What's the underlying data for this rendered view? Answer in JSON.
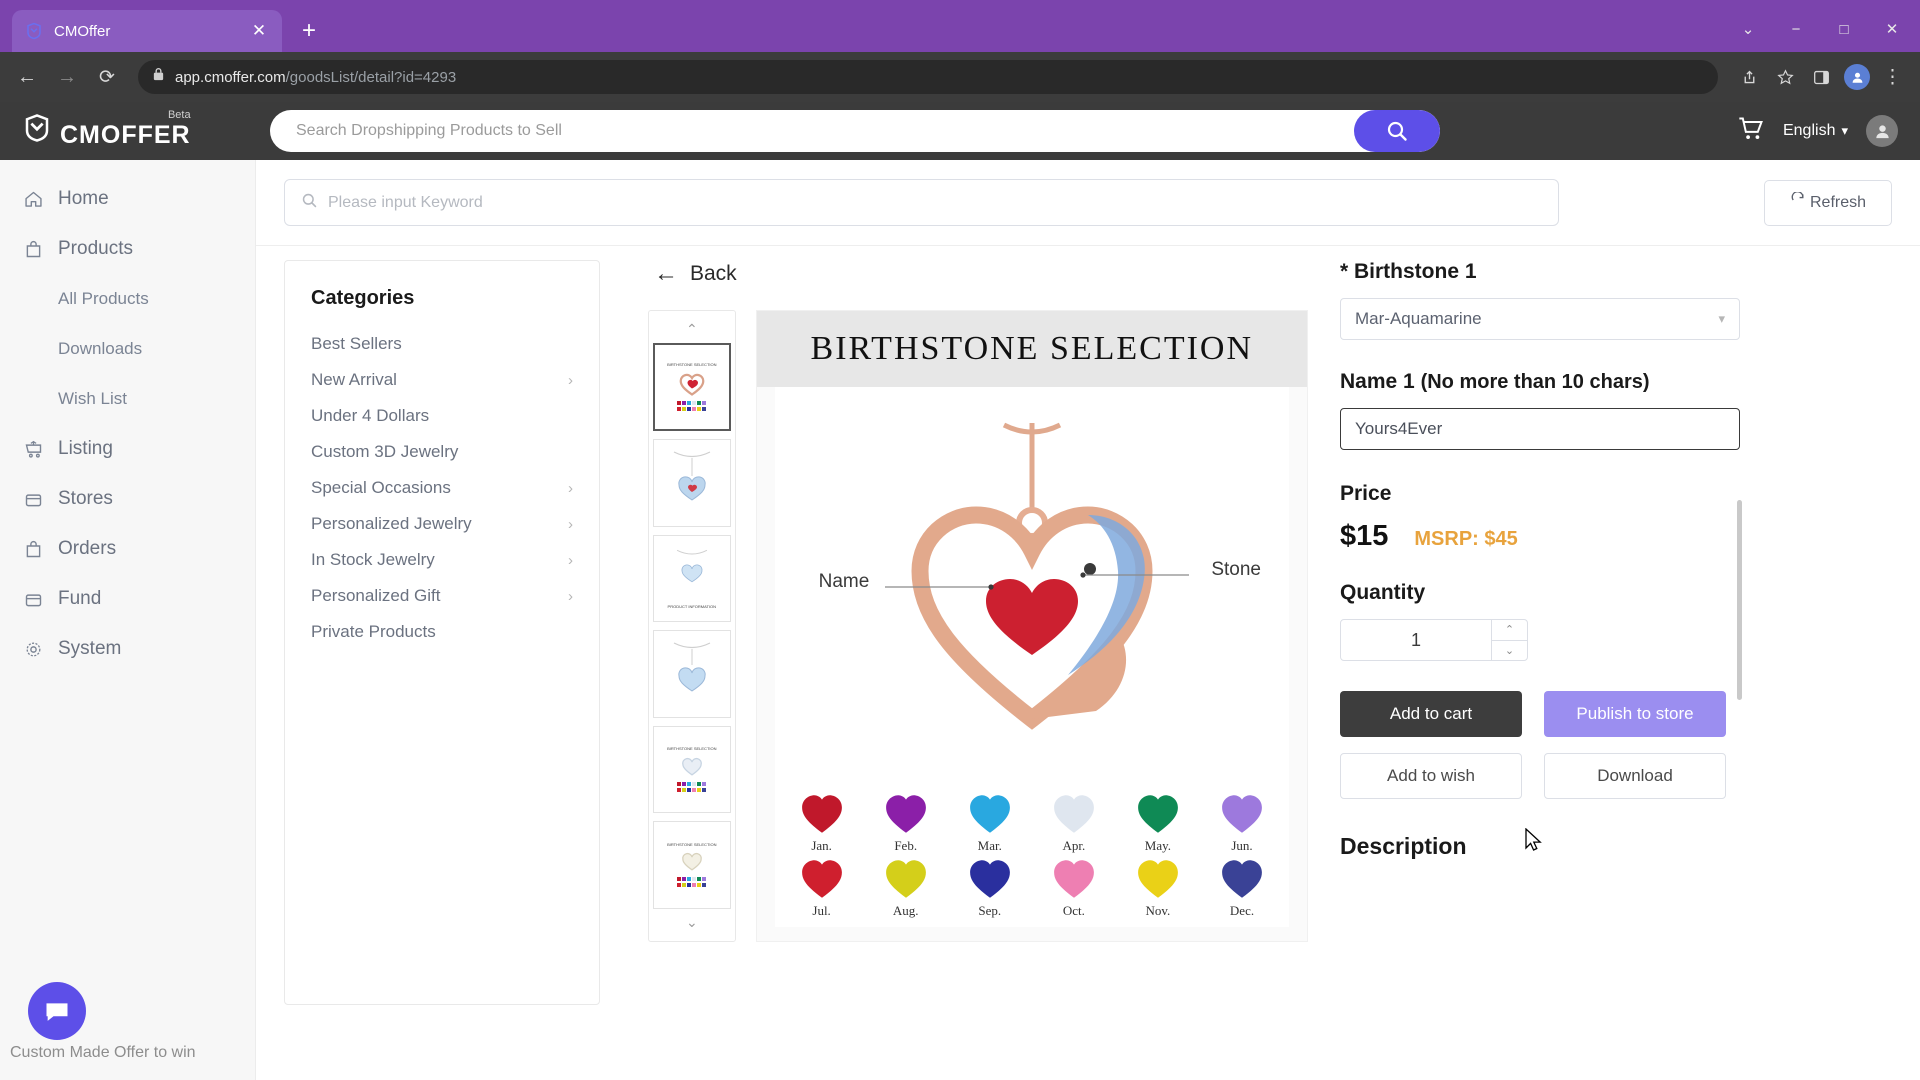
{
  "browser": {
    "tab": {
      "title": "CMOffer",
      "favicon": "cmoffer-logo-icon",
      "close": "✕"
    },
    "new_tab": "+",
    "window_controls": {
      "minimize": "−",
      "maximize": "□",
      "close": "✕",
      "chevron": "⌄"
    },
    "nav": {
      "back": "←",
      "forward": "→",
      "reload": "⟳"
    },
    "url": {
      "scheme_icon": "lock-icon",
      "host": "app.cmoffer.com",
      "path": "/goodsList/detail?id=4293"
    },
    "toolbar_icons": [
      "share-icon",
      "bookmark-star-icon",
      "sidepanel-icon",
      "profile-icon",
      "menu-kebab-icon"
    ]
  },
  "header": {
    "brand": "CMOFFER",
    "brand_badge": "Beta",
    "search_placeholder": "Search Dropshipping Products to Sell",
    "search_value": "",
    "cart_icon": "cart-icon",
    "language": "English",
    "language_chevron": "⌄",
    "account_icon": "account-icon"
  },
  "sidebar": {
    "items": [
      {
        "label": "Home",
        "icon": "home-icon",
        "type": "top"
      },
      {
        "label": "Products",
        "icon": "bag-icon",
        "type": "top"
      },
      {
        "label": "All Products",
        "icon": "",
        "type": "sub"
      },
      {
        "label": "Downloads",
        "icon": "",
        "type": "sub"
      },
      {
        "label": "Wish List",
        "icon": "",
        "type": "sub"
      },
      {
        "label": "Listing",
        "icon": "listing-cart-icon",
        "type": "top"
      },
      {
        "label": "Stores",
        "icon": "store-icon",
        "type": "top"
      },
      {
        "label": "Orders",
        "icon": "bag-icon",
        "type": "top"
      },
      {
        "label": "Fund",
        "icon": "store-icon",
        "type": "top"
      },
      {
        "label": "System",
        "icon": "gear-icon",
        "type": "top"
      }
    ],
    "footnote": "Custom Made Offer to win"
  },
  "searchbar": {
    "placeholder": "Please input Keyword",
    "value": "",
    "refresh_label": "Refresh",
    "refresh_icon": "refresh-icon"
  },
  "categories": {
    "title": "Categories",
    "items": [
      {
        "label": "Best Sellers",
        "expandable": false
      },
      {
        "label": "New Arrival",
        "expandable": true
      },
      {
        "label": "Under 4 Dollars",
        "expandable": false
      },
      {
        "label": "Custom 3D Jewelry",
        "expandable": false
      },
      {
        "label": "Special Occasions",
        "expandable": true
      },
      {
        "label": "Personalized Jewelry",
        "expandable": true
      },
      {
        "label": "In Stock Jewelry",
        "expandable": true
      },
      {
        "label": "Personalized Gift",
        "expandable": true
      },
      {
        "label": "Private Products",
        "expandable": false
      }
    ],
    "chevron": "›"
  },
  "detail": {
    "back_label": "Back",
    "back_icon": "arrow-left-icon",
    "gallery": {
      "up_arrow": "⌃",
      "down_arrow": "⌄",
      "selected_index": 0,
      "thumbnails": [
        {
          "caption": "BIRTHSTONE SELECTION"
        },
        {
          "caption": ""
        },
        {
          "caption": "PRODUCT INFORMATION"
        },
        {
          "caption": ""
        },
        {
          "caption": "BIRTHSTONE SELECTION"
        },
        {
          "caption": "BIRTHSTONE SELECTION"
        }
      ]
    },
    "hero": {
      "title": "BIRTHSTONE SELECTION",
      "annotation_left": "Name",
      "annotation_right": "Stone",
      "months_row1": [
        "Jan.",
        "Feb.",
        "Mar.",
        "Apr.",
        "May.",
        "Jun."
      ],
      "months_row2": [
        "Jul.",
        "Aug.",
        "Sep.",
        "Oct.",
        "Nov.",
        "Dec."
      ],
      "colors_row1": [
        "#c0182b",
        "#8b1fa8",
        "#29a8e0",
        "#dfe6ef",
        "#0f8a55",
        "#9d79dd"
      ],
      "colors_row2": [
        "#cf1f2e",
        "#d4cf1a",
        "#2a2f9e",
        "#ee7fb2",
        "#ead117",
        "#3a4296"
      ]
    },
    "options": {
      "birthstone_label": "* Birthstone 1",
      "birthstone_value": "Mar-Aquamarine",
      "birthstone_chevron": "⌄",
      "name_label": "Name 1",
      "name_hint": "(No more than 10 chars)",
      "name_value": "Yours4Ever"
    },
    "price": {
      "label": "Price",
      "value": "$15",
      "msrp": "MSRP: $45"
    },
    "quantity": {
      "label": "Quantity",
      "value": "1",
      "up": "⌃",
      "down": "⌄"
    },
    "actions": {
      "add_to_cart": "Add to cart",
      "publish_to_store": "Publish to store",
      "add_to_wish": "Add to wish",
      "download": "Download"
    },
    "description_label": "Description"
  },
  "colors": {
    "brand_purple": "#5d4fe8",
    "chrome_purple": "#7b44ad",
    "msrp_orange": "#e8a33d",
    "dark_button": "#3d3d3d",
    "light_purple_button": "#9b8ef0"
  }
}
